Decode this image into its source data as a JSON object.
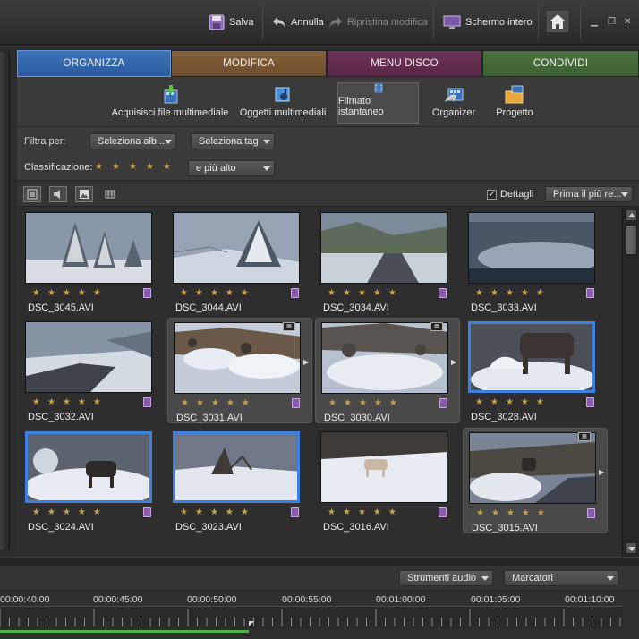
{
  "topbar": {
    "save": "Salva",
    "undo": "Annulla",
    "redo": "Ripristina modifica",
    "fullscreen": "Schermo intero",
    "home_icon": "home-icon"
  },
  "tabs": [
    {
      "label": "ORGANIZZA",
      "color": "#2f63ab",
      "active": true
    },
    {
      "label": "MODIFICA",
      "color": "#7a5633"
    },
    {
      "label": "MENU DISCO",
      "color": "#632d4e"
    },
    {
      "label": "CONDIVIDI",
      "color": "#456839"
    }
  ],
  "tools": [
    {
      "label": "Acquisisci file multimediale",
      "icon": "import-media-icon"
    },
    {
      "label": "Oggetti multimediali",
      "icon": "media-objects-icon"
    },
    {
      "label": "Filmato istantaneo",
      "icon": "instant-movie-icon",
      "active": true
    },
    {
      "label": "Organizer",
      "icon": "organizer-icon"
    },
    {
      "label": "Progetto",
      "icon": "project-folder-icon"
    }
  ],
  "filters": {
    "filter_label": "Filtra per:",
    "album_select": "Seleziona alb...",
    "tag_select": "Seleziona tag",
    "rating_label": "Classificazione:",
    "rating_select": "e più alto"
  },
  "viewbar": {
    "details_label": "Dettagli",
    "details_checked": true,
    "sort_select": "Prima il più re..."
  },
  "clips": [
    {
      "name": "DSC_3045.AVI",
      "scene": "trees"
    },
    {
      "name": "DSC_3044.AVI",
      "scene": "trees2"
    },
    {
      "name": "DSC_3034.AVI",
      "scene": "road"
    },
    {
      "name": "DSC_3033.AVI",
      "scene": "blur"
    },
    {
      "name": "DSC_3032.AVI",
      "scene": "road2"
    },
    {
      "name": "DSC_3031.AVI",
      "scene": "rocks",
      "highlight": true
    },
    {
      "name": "DSC_3030.AVI",
      "scene": "rocks2",
      "highlight": true
    },
    {
      "name": "DSC_3028.AVI",
      "scene": "animal",
      "selected": true
    },
    {
      "name": "DSC_3024.AVI",
      "scene": "animal2",
      "selected": true
    },
    {
      "name": "DSC_3023.AVI",
      "scene": "hill",
      "selected": true
    },
    {
      "name": "DSC_3016.AVI",
      "scene": "field"
    },
    {
      "name": "DSC_3015.AVI",
      "scene": "animal3",
      "highlight": true
    }
  ],
  "timeline": {
    "audio_tools": "Strumenti audio",
    "markers": "Marcatori",
    "timecodes": [
      "00:00:40:00",
      "00:00:45:00",
      "00:00:50:00",
      "00:00:55:00",
      "00:01:00:00",
      "00:01:05:00",
      "00:01:10:00"
    ]
  },
  "colors": {
    "star": "#c9a24a",
    "selection": "#3e7fe0",
    "tag": "#8a5ab0",
    "timeline_green": "#4fb24a"
  }
}
